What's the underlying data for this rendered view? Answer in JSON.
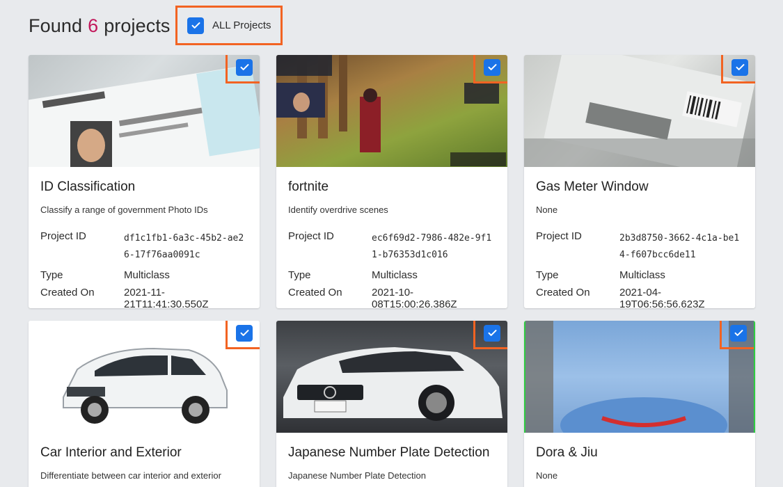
{
  "header": {
    "found_prefix": "Found",
    "count": "6",
    "found_suffix": "projects",
    "all_projects_label": "ALL Projects"
  },
  "labels": {
    "project_id": "Project ID",
    "type": "Type",
    "created_on": "Created On"
  },
  "projects": [
    {
      "title": "ID Classification",
      "description": "Classify a range of government Photo IDs",
      "project_id": "df1c1fb1-6a3c-45b2-ae26-17f76aa0091c",
      "type": "Multiclass",
      "created_on": "2021-11-21T11:41:30.550Z",
      "checked": true
    },
    {
      "title": "fortnite",
      "description": "Identify overdrive scenes",
      "project_id": "ec6f69d2-7986-482e-9f11-b76353d1c016",
      "type": "Multiclass",
      "created_on": "2021-10-08T15:00:26.386Z",
      "checked": true
    },
    {
      "title": "Gas Meter Window",
      "description": "None",
      "project_id": "2b3d8750-3662-4c1a-be14-f607bcc6de11",
      "type": "Multiclass",
      "created_on": "2021-04-19T06:56:56.623Z",
      "checked": true
    },
    {
      "title": "Car Interior and Exterior",
      "description": "Differentiate between car interior and exterior",
      "checked": true
    },
    {
      "title": "Japanese Number Plate Detection",
      "description": "Japanese Number Plate Detection",
      "checked": true
    },
    {
      "title": "Dora & Jiu",
      "description": "None",
      "checked": true
    }
  ],
  "colors": {
    "accent": "#1a73e8",
    "highlight": "#f26322",
    "mono_text": "#c2185b",
    "page_bg": "#e8eaed"
  },
  "icons": {
    "checkbox": "checkmark-icon"
  }
}
